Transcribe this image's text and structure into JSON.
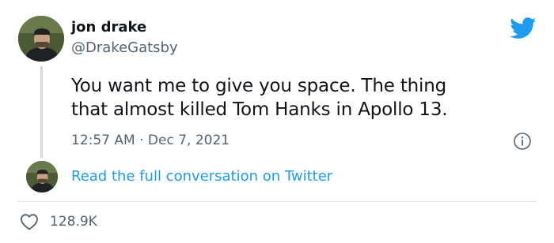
{
  "tweet": {
    "display_name": "jon drake",
    "handle": "@DrakeGatsby",
    "text_lines": [
      "You want me to give you space. The thing",
      "that almost killed Tom Hanks in Apollo 13."
    ],
    "timestamp": "12:57 AM · Dec 7, 2021",
    "read_link": "Read the full conversation on Twitter",
    "like_count": "128.9K"
  },
  "icons": {
    "brand": "twitter-bird-icon",
    "info": "info-icon",
    "like": "heart-icon"
  },
  "colors": {
    "accent": "#1d9bf0",
    "text": "#0f1419",
    "secondary": "#536471",
    "divider": "#dde3e7"
  }
}
